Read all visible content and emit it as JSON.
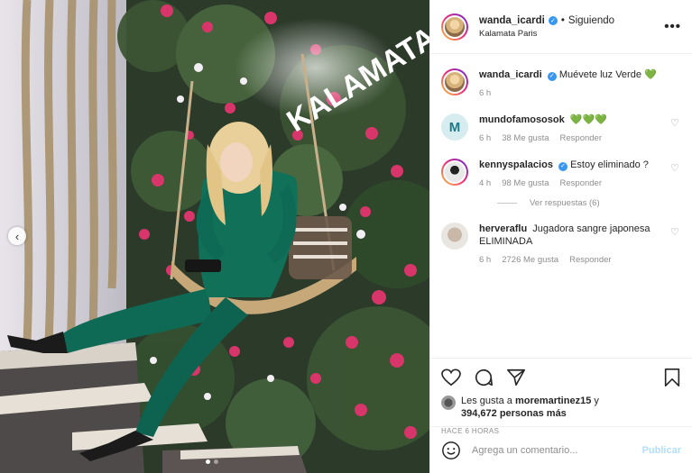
{
  "post": {
    "username": "wanda_icardi",
    "follow_status": "Siguiendo",
    "location": "Kalamata Paris",
    "more_icon": "more-horizontal-icon"
  },
  "photo": {
    "sign_text": "KALAMATA",
    "slide_count": 2,
    "active_slide": 1
  },
  "comments": [
    {
      "username": "wanda_icardi",
      "text": "Muévete luz Verde",
      "emoji": "💚",
      "time": "6 h",
      "likes": "",
      "reply": ""
    },
    {
      "username": "mundofamososok",
      "text": "",
      "emoji": "💚💚💚",
      "time": "6 h",
      "likes": "38 Me gusta",
      "reply": "Responder"
    },
    {
      "username": "kennyspalacios",
      "text": "Estoy eliminado ?",
      "emoji": "",
      "time": "4 h",
      "likes": "98 Me gusta",
      "reply": "Responder"
    },
    {
      "username": "herveraflu",
      "text": "Jugadora sangre japonesa ELIMINADA",
      "emoji": "",
      "time": "6 h",
      "likes": "2726 Me gusta",
      "reply": "Responder"
    }
  ],
  "view_replies": "Ver respuestas (6)",
  "likes_summary": {
    "prefix": "Les gusta a",
    "user": "moremartinez15",
    "mid": "y",
    "count": "394,672 personas más"
  },
  "post_time": "HACE 6 HORAS",
  "add_comment": {
    "placeholder": "Agrega un comentario...",
    "publish_label": "Publicar"
  },
  "colors": {
    "verified": "#3897f0",
    "publish": "#b2dffc",
    "meta_gray": "#8e8e8e",
    "dress_green": "#0f6a55"
  }
}
